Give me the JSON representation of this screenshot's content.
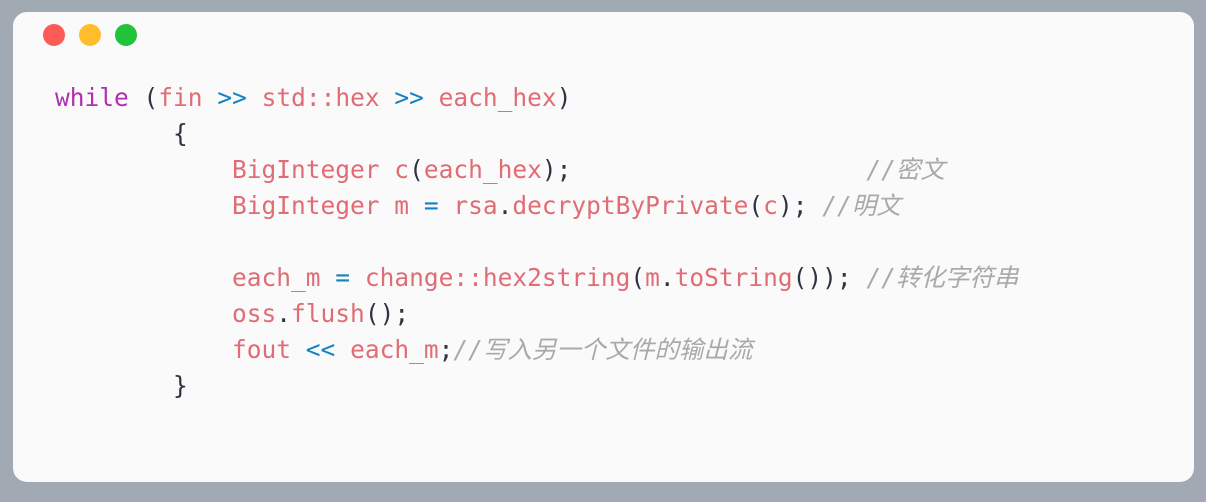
{
  "window": {
    "titlebar": {
      "close_label": "close",
      "minimize_label": "minimize",
      "maximize_label": "maximize"
    },
    "colors": {
      "page_background": "#a1a9b2",
      "card_background": "#fafafa",
      "close_dot": "#fc5b56",
      "minimize_dot": "#ffbd2c",
      "maximize_dot": "#21c33b",
      "keyword": "#b030b0",
      "identifier": "#e06c75",
      "operator": "#1282c0",
      "punctuation": "#2e3440",
      "comment": "#a9a9a9"
    }
  },
  "code": {
    "language": "cpp",
    "lines": [
      {
        "indent": "",
        "tokens": [
          {
            "t": "while",
            "k": "kw"
          },
          {
            "t": " ",
            "k": "punct"
          },
          {
            "t": "(",
            "k": "punct"
          },
          {
            "t": "fin",
            "k": "id"
          },
          {
            "t": " ",
            "k": "punct"
          },
          {
            "t": ">>",
            "k": "op"
          },
          {
            "t": " ",
            "k": "punct"
          },
          {
            "t": "std::hex",
            "k": "id"
          },
          {
            "t": " ",
            "k": "punct"
          },
          {
            "t": ">>",
            "k": "op"
          },
          {
            "t": " ",
            "k": "punct"
          },
          {
            "t": "each_hex",
            "k": "id"
          },
          {
            "t": ")",
            "k": "punct"
          }
        ]
      },
      {
        "indent": "        ",
        "tokens": [
          {
            "t": "{",
            "k": "punct"
          }
        ]
      },
      {
        "indent": "            ",
        "tokens": [
          {
            "t": "BigInteger",
            "k": "id"
          },
          {
            "t": " ",
            "k": "punct"
          },
          {
            "t": "c",
            "k": "id"
          },
          {
            "t": "(",
            "k": "punct"
          },
          {
            "t": "each_hex",
            "k": "id"
          },
          {
            "t": ");",
            "k": "punct"
          },
          {
            "t": "                    ",
            "k": "punct"
          },
          {
            "t": "//",
            "k": "cmt-slash"
          },
          {
            "t": "密文",
            "k": "cmt"
          }
        ]
      },
      {
        "indent": "            ",
        "tokens": [
          {
            "t": "BigInteger",
            "k": "id"
          },
          {
            "t": " ",
            "k": "punct"
          },
          {
            "t": "m",
            "k": "id"
          },
          {
            "t": " ",
            "k": "punct"
          },
          {
            "t": "=",
            "k": "op"
          },
          {
            "t": " ",
            "k": "punct"
          },
          {
            "t": "rsa",
            "k": "id"
          },
          {
            "t": ".",
            "k": "punct"
          },
          {
            "t": "decryptByPrivate",
            "k": "id"
          },
          {
            "t": "(",
            "k": "punct"
          },
          {
            "t": "c",
            "k": "id"
          },
          {
            "t": "); ",
            "k": "punct"
          },
          {
            "t": "//",
            "k": "cmt-slash"
          },
          {
            "t": "明文",
            "k": "cmt"
          }
        ]
      },
      {
        "indent": "",
        "tokens": []
      },
      {
        "indent": "            ",
        "tokens": [
          {
            "t": "each_m",
            "k": "id"
          },
          {
            "t": " ",
            "k": "punct"
          },
          {
            "t": "=",
            "k": "op"
          },
          {
            "t": " ",
            "k": "punct"
          },
          {
            "t": "change::hex2string",
            "k": "id"
          },
          {
            "t": "(",
            "k": "punct"
          },
          {
            "t": "m",
            "k": "id"
          },
          {
            "t": ".",
            "k": "punct"
          },
          {
            "t": "toString",
            "k": "id"
          },
          {
            "t": "()); ",
            "k": "punct"
          },
          {
            "t": "//",
            "k": "cmt-slash"
          },
          {
            "t": "转化字符串",
            "k": "cmt"
          }
        ]
      },
      {
        "indent": "            ",
        "tokens": [
          {
            "t": "oss",
            "k": "id"
          },
          {
            "t": ".",
            "k": "punct"
          },
          {
            "t": "flush",
            "k": "id"
          },
          {
            "t": "();",
            "k": "punct"
          }
        ]
      },
      {
        "indent": "            ",
        "tokens": [
          {
            "t": "fout",
            "k": "id"
          },
          {
            "t": " ",
            "k": "punct"
          },
          {
            "t": "<<",
            "k": "op"
          },
          {
            "t": " ",
            "k": "punct"
          },
          {
            "t": "each_m",
            "k": "id"
          },
          {
            "t": ";",
            "k": "punct"
          },
          {
            "t": "//",
            "k": "cmt-slash"
          },
          {
            "t": "写入另一个文件的输出流",
            "k": "cmt"
          }
        ]
      },
      {
        "indent": "        ",
        "tokens": [
          {
            "t": "}",
            "k": "punct"
          }
        ]
      }
    ]
  }
}
